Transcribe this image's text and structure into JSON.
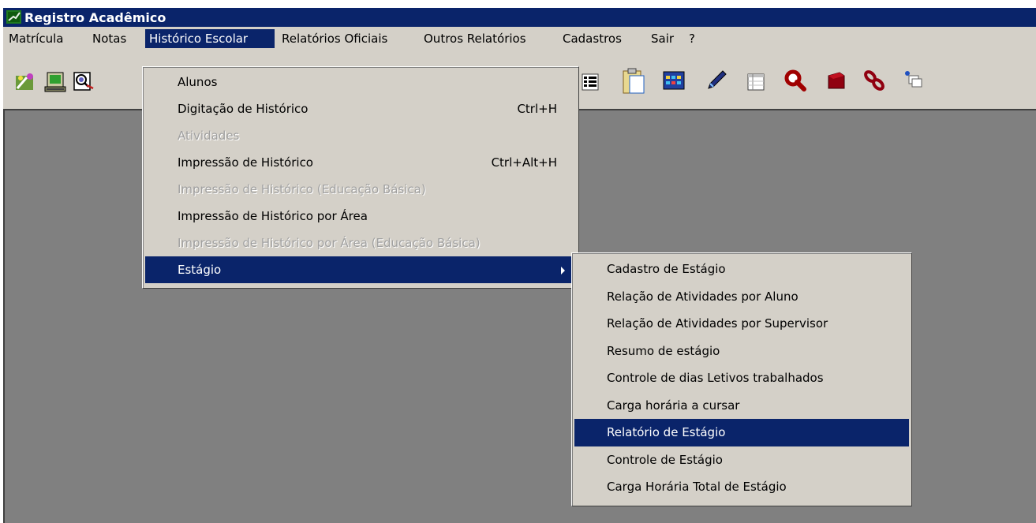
{
  "window": {
    "title": "Registro Acadêmico"
  },
  "menubar": {
    "items": [
      {
        "label": "Matrícula"
      },
      {
        "label": "Notas"
      },
      {
        "label": "Histórico Escolar"
      },
      {
        "label": "Relatórios Oficiais"
      },
      {
        "label": "Outros Relatórios"
      },
      {
        "label": "Cadastros"
      },
      {
        "label": "Sair"
      },
      {
        "label": "?"
      }
    ],
    "open_menu": "Histórico Escolar"
  },
  "historico_menu": {
    "items": [
      {
        "label": "Alunos",
        "shortcut": "",
        "enabled": true
      },
      {
        "label": "Digitação de Histórico",
        "shortcut": "Ctrl+H",
        "enabled": true
      },
      {
        "label": "Atividades",
        "shortcut": "",
        "enabled": false
      },
      {
        "label": "Impressão de Histórico",
        "shortcut": "Ctrl+Alt+H",
        "enabled": true
      },
      {
        "label": "Impressão de Histórico (Educação Básica)",
        "shortcut": "",
        "enabled": false
      },
      {
        "label": "Impressão de Histórico por Área",
        "shortcut": "",
        "enabled": true
      },
      {
        "label": "Impressão de Histórico por Área (Educação Básica)",
        "shortcut": "",
        "enabled": false
      },
      {
        "label": "Estágio",
        "shortcut": "",
        "enabled": true,
        "highlighted": true,
        "has_submenu": true
      }
    ]
  },
  "estagio_submenu": {
    "items": [
      {
        "label": "Cadastro de Estágio"
      },
      {
        "label": "Relação de Atividades por Aluno"
      },
      {
        "label": "Relação de Atividades por Supervisor"
      },
      {
        "label": "Resumo de estágio"
      },
      {
        "label": "Controle de dias Letivos trabalhados"
      },
      {
        "label": "Carga horária a cursar"
      },
      {
        "label": "Relatório de Estágio",
        "highlighted": true
      },
      {
        "label": "Controle de Estágio"
      },
      {
        "label": "Carga Horária Total de Estágio"
      }
    ]
  },
  "toolbar": {
    "icons": [
      "wizard-icon",
      "computer-icon",
      "search-document-icon",
      "list-icon",
      "clipboard-icon",
      "calendar-grid-icon",
      "pen-icon",
      "table-icon",
      "magnifier-icon",
      "book-icon",
      "link-icon",
      "windows-icon"
    ]
  },
  "colors": {
    "highlight": "#0a246a",
    "face": "#d4d0c8",
    "workspace": "#808080"
  }
}
